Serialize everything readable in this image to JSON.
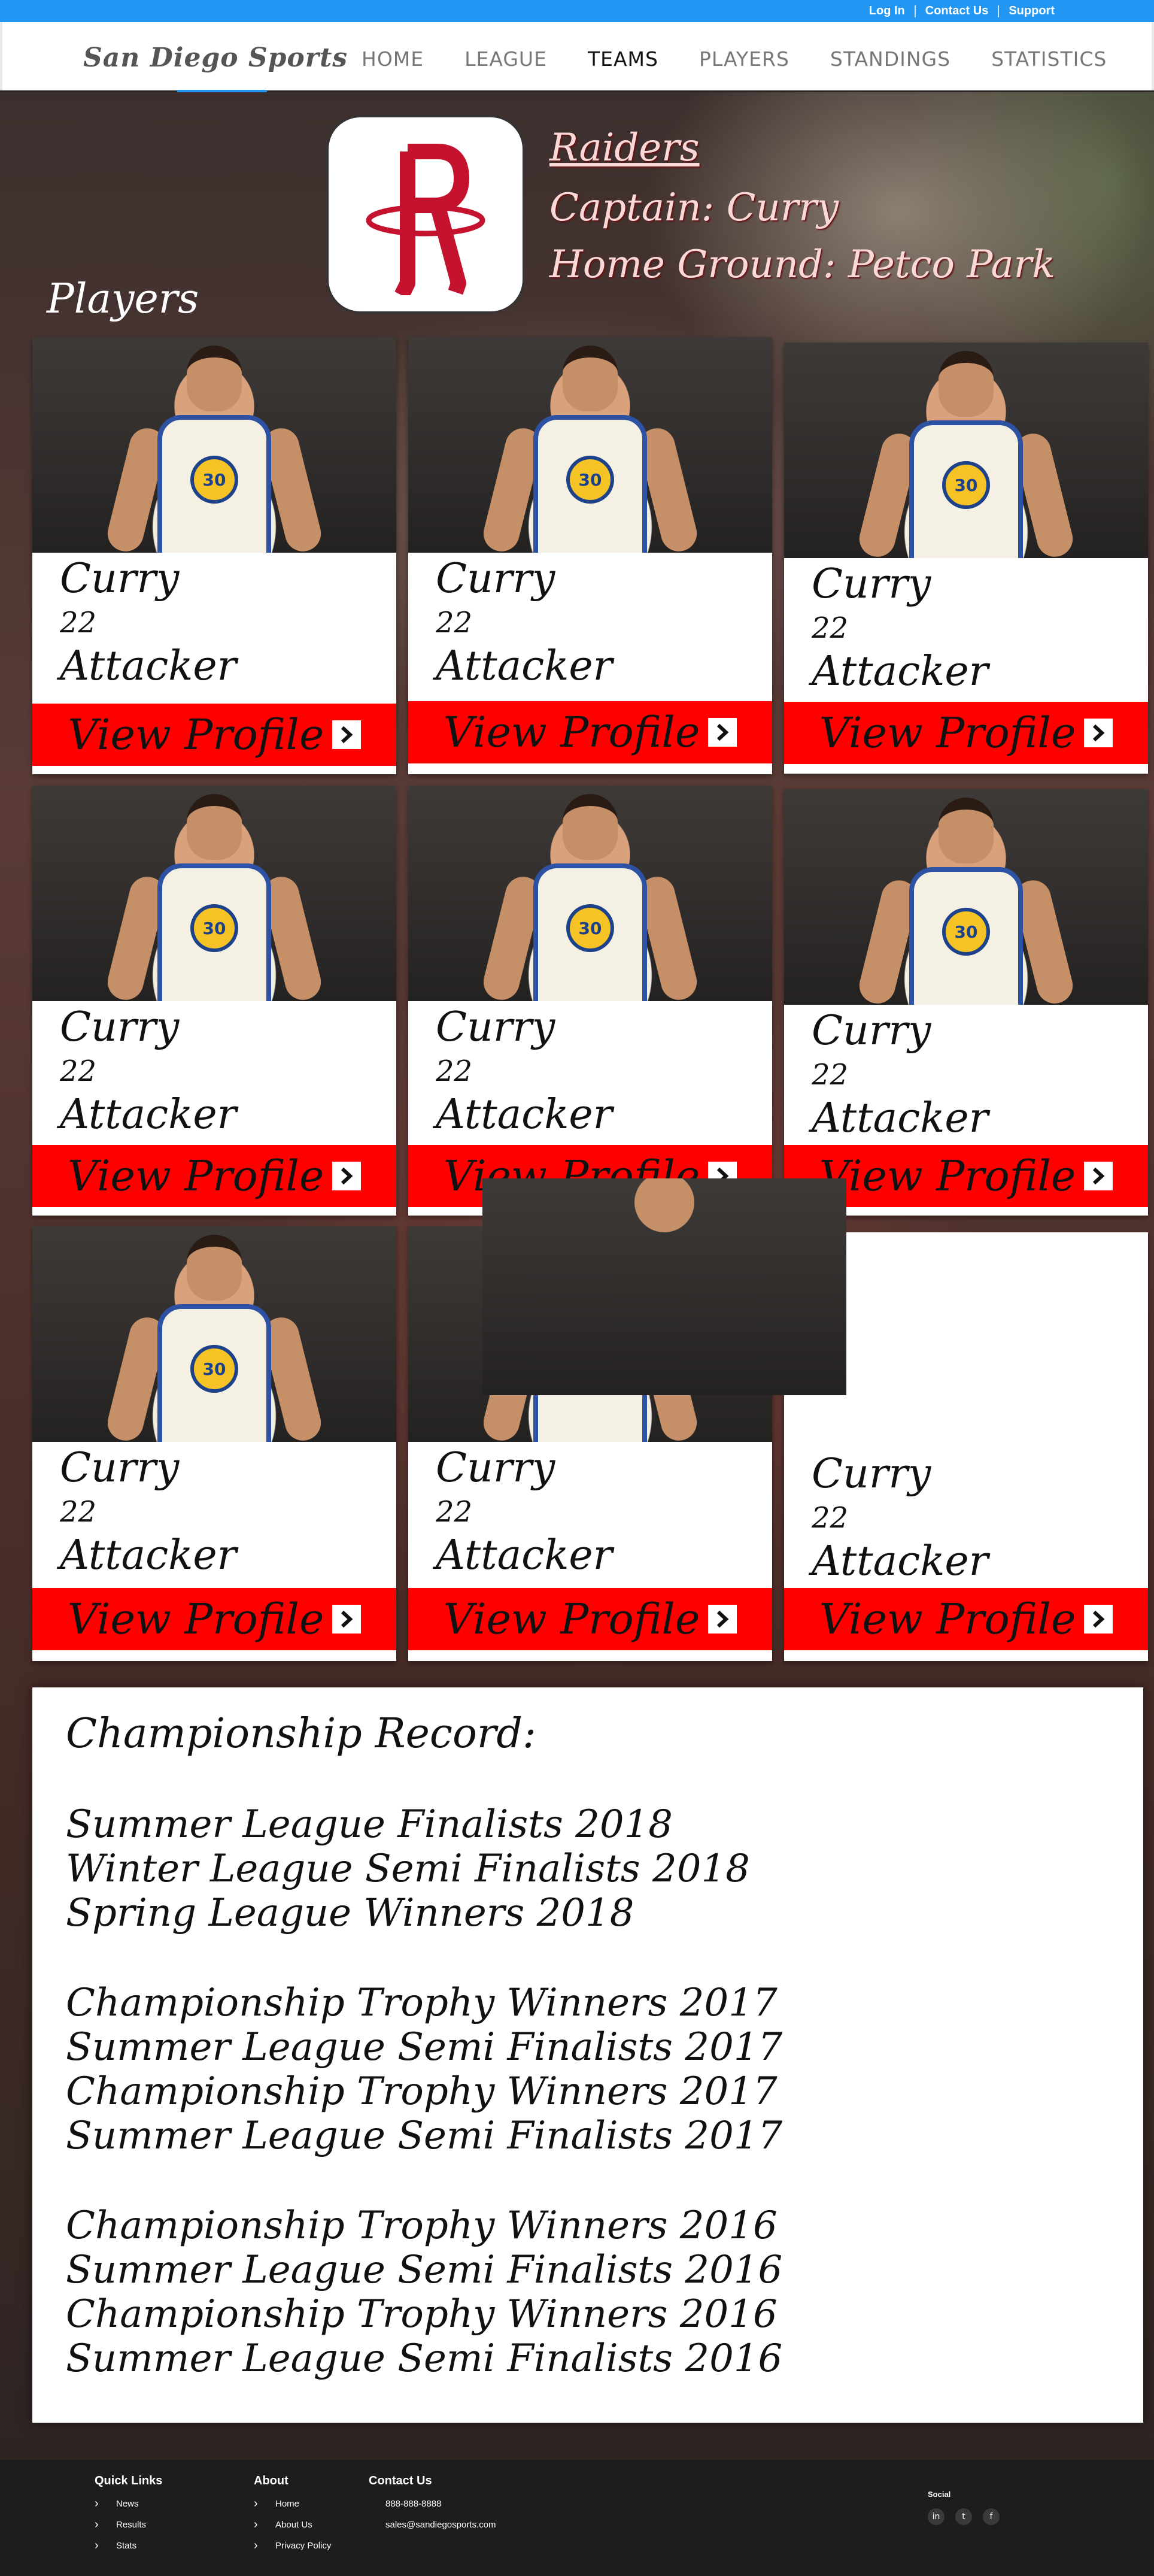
{
  "topbar": {
    "links": [
      "Log In",
      "Contact Us",
      "Support"
    ]
  },
  "header": {
    "logo": "San Diego Sports",
    "nav": [
      "HOME",
      "LEAGUE",
      "TEAMS",
      "PLAYERS",
      "STANDINGS",
      "STATISTICS"
    ],
    "active_nav": "TEAMS"
  },
  "team": {
    "name": "Raiders",
    "captain": "Captain: Curry",
    "home_ground": "Home Ground: Petco Park",
    "logo_icon": "rockets-r-logo"
  },
  "players_heading": "Players",
  "players": [
    {
      "name": "Curry",
      "number": "22",
      "role": "Attacker",
      "button": "View Profile"
    },
    {
      "name": "Curry",
      "number": "22",
      "role": "Attacker",
      "button": "View Profile"
    },
    {
      "name": "Curry",
      "number": "22",
      "role": "Attacker",
      "button": "View Profile"
    },
    {
      "name": "Curry",
      "number": "22",
      "role": "Attacker",
      "button": "View Profile"
    },
    {
      "name": "Curry",
      "number": "22",
      "role": "Attacker",
      "button": "View Profile"
    },
    {
      "name": "Curry",
      "number": "22",
      "role": "Attacker",
      "button": "View Profile"
    },
    {
      "name": "Curry",
      "number": "22",
      "role": "Attacker",
      "button": "View Profile"
    },
    {
      "name": "Curry",
      "number": "22",
      "role": "Attacker",
      "button": "View Profile"
    },
    {
      "name": "Curry",
      "number": "22",
      "role": "Attacker",
      "button": "View Profile"
    }
  ],
  "jersey_number": "30",
  "record": {
    "title": "Championship Record:",
    "groups": [
      [
        "Summer League Finalists 2018",
        "Winter League Semi Finalists 2018",
        "Spring League Winners 2018"
      ],
      [
        "Championship Trophy Winners 2017",
        "Summer League Semi Finalists 2017",
        "Championship Trophy Winners 2017",
        "Summer League Semi Finalists 2017"
      ],
      [
        "Championship Trophy Winners 2016",
        "Summer League Semi Finalists 2016",
        "Championship Trophy Winners 2016",
        "Summer League Semi Finalists 2016"
      ]
    ]
  },
  "footer": {
    "quick_links": {
      "title": "Quick Links",
      "items": [
        "News",
        "Results",
        "Stats"
      ]
    },
    "about": {
      "title": "About",
      "items": [
        "Home",
        "About Us",
        "Privacy Policy"
      ]
    },
    "contact": {
      "title": "Contact Us",
      "phone": "888-888-8888",
      "email": "sales@sandiegosports.com"
    },
    "social": {
      "title": "Social",
      "icons": [
        "linkedin-icon",
        "twitter-icon",
        "facebook-icon"
      ],
      "glyphs": [
        "in",
        "t",
        "f"
      ]
    }
  },
  "colors": {
    "accent": "#2196f3",
    "button": "#ff0000",
    "team_text": "#fbd8d8"
  }
}
